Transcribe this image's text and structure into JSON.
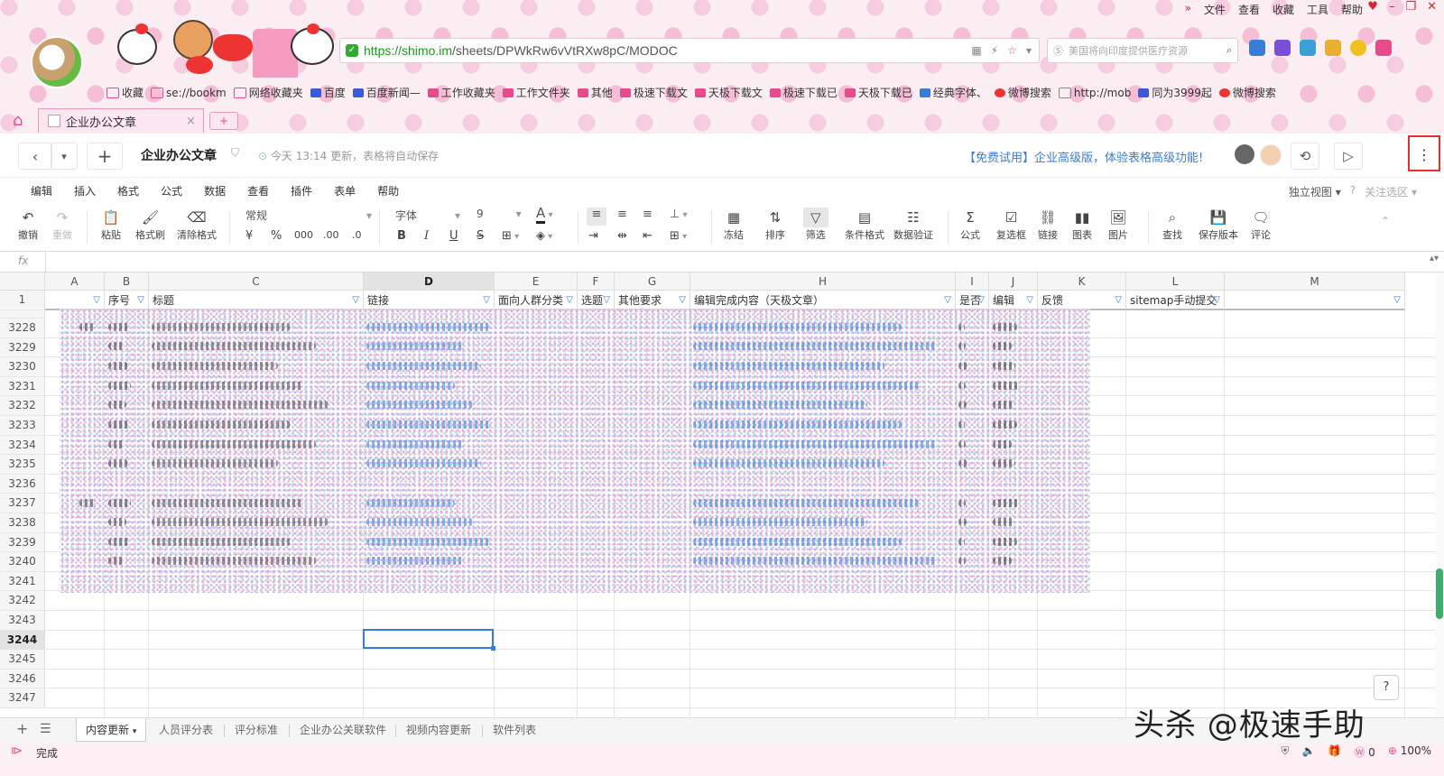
{
  "browser": {
    "menu": [
      "文件",
      "查看",
      "收藏",
      "工具",
      "帮助"
    ],
    "url_host": "https://shimo.im",
    "url_path": "/sheets/DPWkRw6vVtRXw8pC/MODOC",
    "search_placeholder": "美国将向印度提供医疗资源",
    "bookmarks": [
      "收藏",
      "se://bookm",
      "网络收藏夹",
      "百度",
      "百度新闻—",
      "工作收藏夹",
      "工作文件夹",
      "其他",
      "极速下载文",
      "天极下载文",
      "极速下载已",
      "天极下载已",
      "经典字体、",
      "微博搜索",
      "http://mob",
      "同为3999起",
      "微博搜索"
    ],
    "tab_title": "企业办公文章",
    "tab_close": "×",
    "new_tab": "+"
  },
  "app": {
    "doc_title": "企业办公文章",
    "save_status": "今天 13:14 更新，表格将自动保存",
    "promo": "【免费试用】企业高级版，体验表格高级功能!",
    "more": "⋮"
  },
  "menubar": {
    "items": [
      "编辑",
      "插入",
      "格式",
      "公式",
      "数据",
      "查看",
      "插件",
      "表单",
      "帮助"
    ],
    "view_mode": "独立视图",
    "help_q": "?",
    "follow": "关注选区"
  },
  "toolbar": {
    "undo": "撤销",
    "redo": "重做",
    "paste": "粘贴",
    "format_painter": "格式刷",
    "clear_format": "清除格式",
    "number_format": "常规",
    "font": "字体",
    "font_size": "9",
    "currency": "¥",
    "percent": "%",
    "thousands": "000",
    "decimal_add": ".00",
    "decimal_remove": ".0",
    "bold": "B",
    "italic": "I",
    "underline": "U",
    "strike": "S",
    "freeze": "冻结",
    "sort": "排序",
    "filter": "筛选",
    "cond_format": "条件格式",
    "validation": "数据验证",
    "formula": "公式",
    "checkbox": "复选框",
    "link": "链接",
    "chart": "图表",
    "image": "图片",
    "find": "查找",
    "save_version": "保存版本",
    "comment": "评论"
  },
  "formula_bar": {
    "fx": "fx"
  },
  "sheet": {
    "columns": [
      "A",
      "B",
      "C",
      "D",
      "E",
      "F",
      "G",
      "H",
      "I",
      "J",
      "K",
      "L",
      "M"
    ],
    "header_row_num": "1",
    "headers": [
      "",
      "序号",
      "标题",
      "链接",
      "面向人群分类",
      "选题",
      "其他要求",
      "编辑完成内容（天极文章）",
      "是否",
      "编辑",
      "反馈",
      "sitemap手动提交",
      ""
    ],
    "rows": [
      "3228",
      "3229",
      "3230",
      "3231",
      "3232",
      "3233",
      "3234",
      "3235",
      "3236",
      "3237",
      "3238",
      "3239",
      "3240",
      "3241",
      "3242",
      "3243",
      "3244",
      "3245",
      "3246",
      "3247"
    ],
    "selected_row": "3244",
    "selected_col": "D",
    "tabs": [
      "内容更新",
      "人员评分表",
      "评分标准",
      "企业办公关联软件",
      "视频内容更新",
      "软件列表"
    ],
    "active_tab": "内容更新",
    "help": "?"
  },
  "watermark": "头杀 @极速手助",
  "status": {
    "text": "完成",
    "count": "0",
    "zoom": "100%"
  },
  "colors": {
    "accent": "#3a7dd8",
    "pink": "#e64c8c",
    "highlight": "#e03030"
  }
}
